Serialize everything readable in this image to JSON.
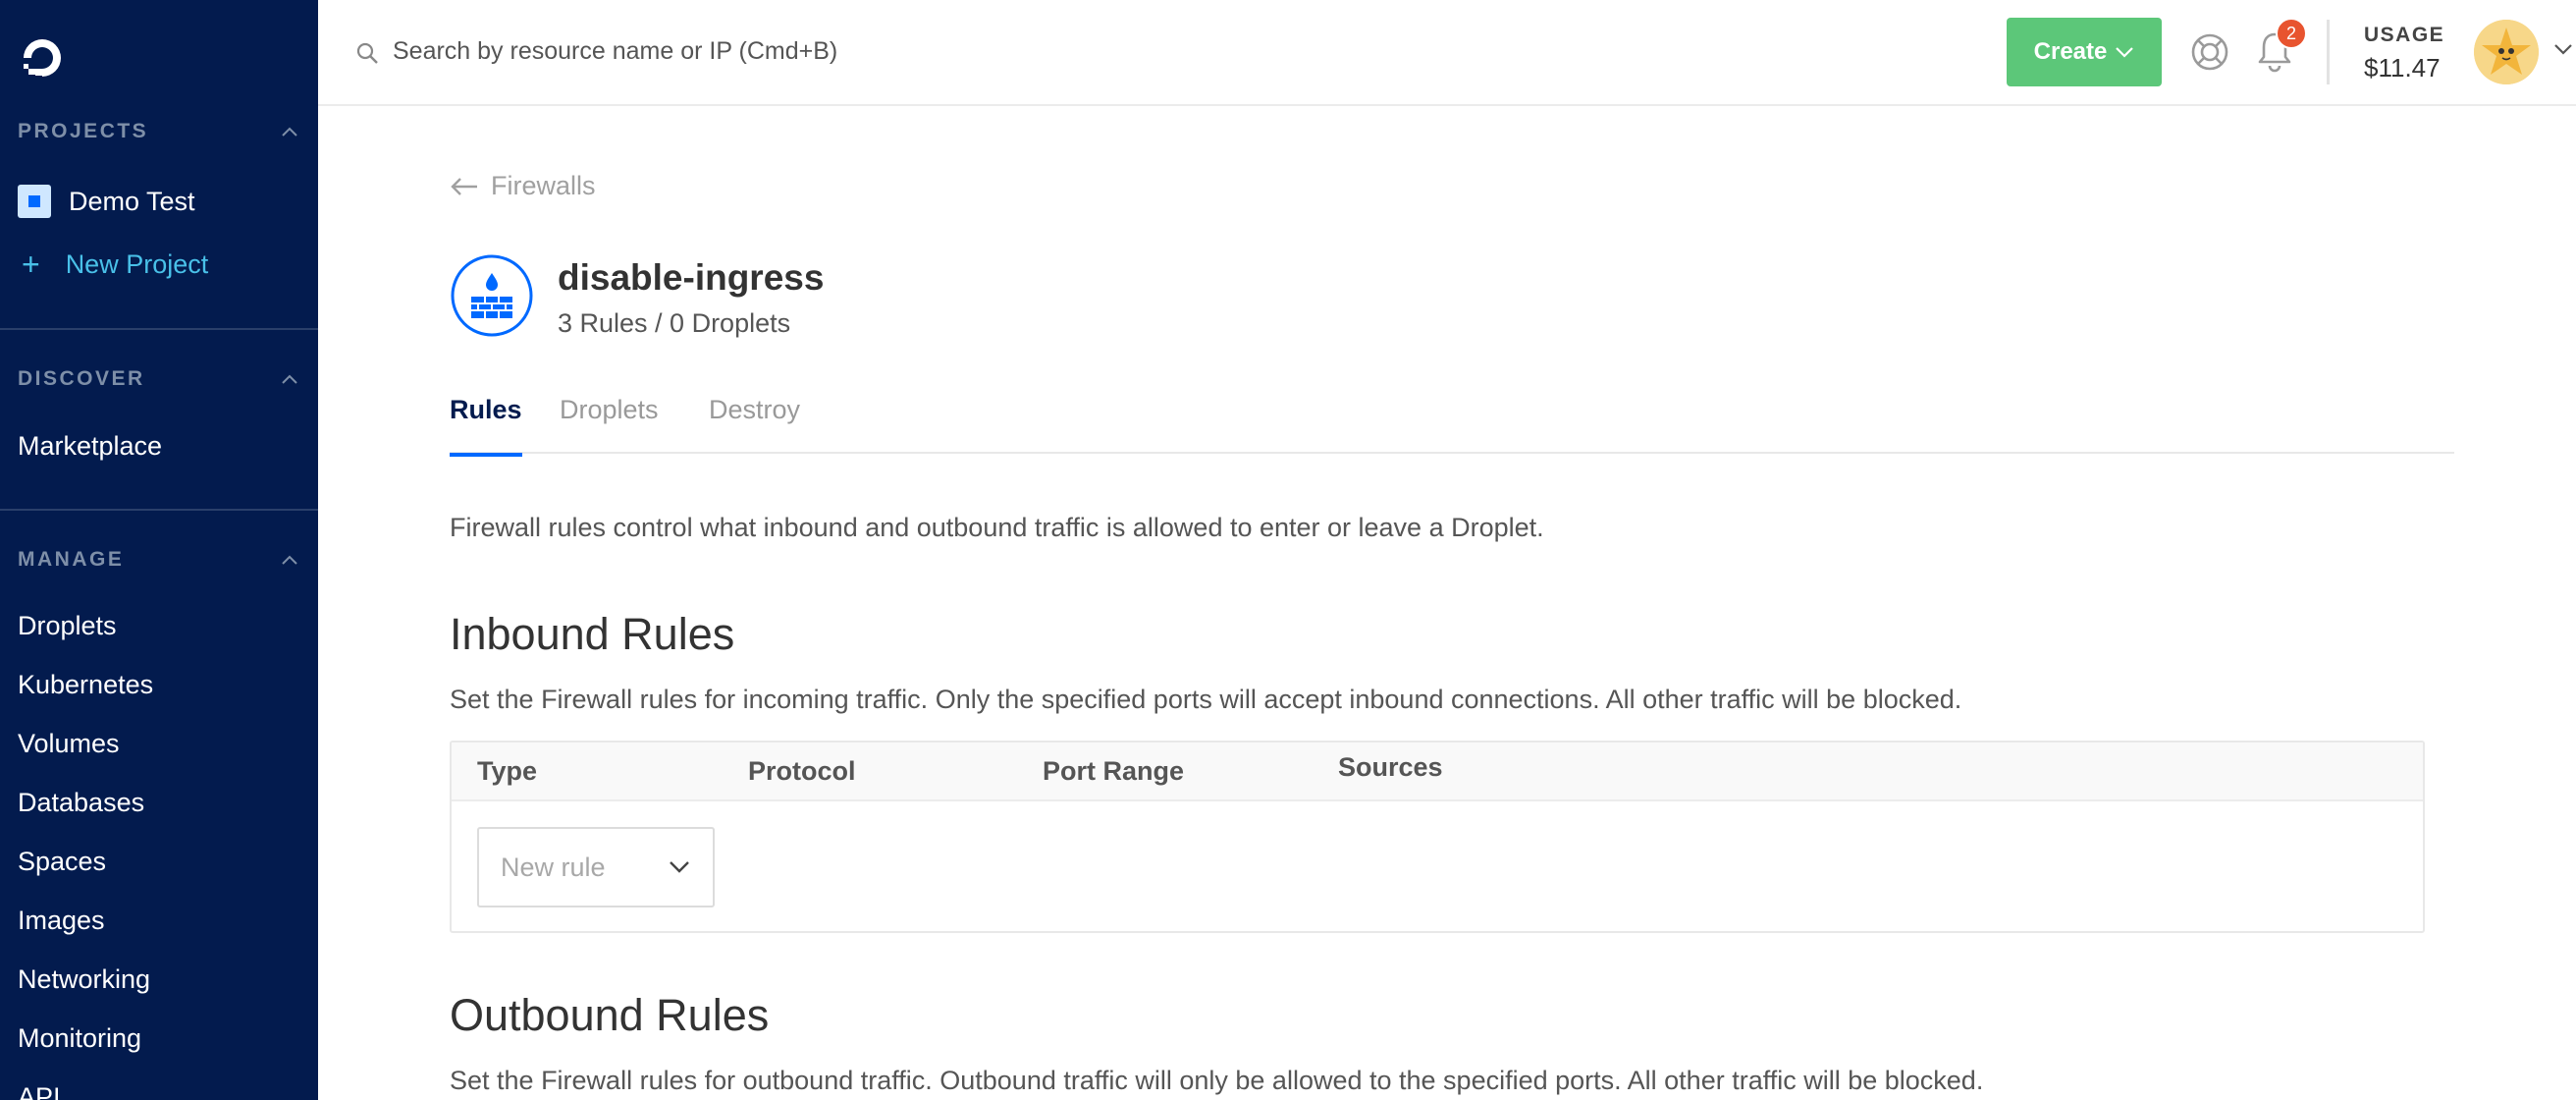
{
  "sidebar": {
    "projects_label": "PROJECTS",
    "project_name": "Demo Test",
    "new_project_label": "New Project",
    "discover_label": "DISCOVER",
    "discover_items": [
      "Marketplace"
    ],
    "manage_label": "MANAGE",
    "manage_items": [
      "Droplets",
      "Kubernetes",
      "Volumes",
      "Databases",
      "Spaces",
      "Images",
      "Networking",
      "Monitoring",
      "API"
    ]
  },
  "topbar": {
    "search_placeholder": "Search by resource name or IP (Cmd+B)",
    "create_label": "Create",
    "notification_count": "2",
    "usage_label": "USAGE",
    "usage_value": "$11.47"
  },
  "page": {
    "back_label": "Firewalls",
    "firewall_name": "disable-ingress",
    "firewall_summary": "3 Rules / 0 Droplets",
    "tabs": [
      "Rules",
      "Droplets",
      "Destroy"
    ],
    "active_tab": "Rules",
    "intro": "Firewall rules control what inbound and outbound traffic is allowed to enter or leave a Droplet.",
    "inbound": {
      "title": "Inbound Rules",
      "description": "Set the Firewall rules for incoming traffic. Only the specified ports will accept inbound connections. All other traffic will be blocked.",
      "columns": [
        "Type",
        "Protocol",
        "Port Range",
        "Sources"
      ],
      "new_rule_placeholder": "New rule"
    },
    "outbound": {
      "title": "Outbound Rules",
      "description": "Set the Firewall rules for outbound traffic. Outbound traffic will only be allowed to the specified ports. All other traffic will be blocked."
    }
  },
  "colors": {
    "sidebar_bg": "#031b4e",
    "accent_blue": "#0069ff",
    "create_green": "#5cc779",
    "badge_red": "#e8542f",
    "new_project_cyan": "#49c0e8"
  }
}
